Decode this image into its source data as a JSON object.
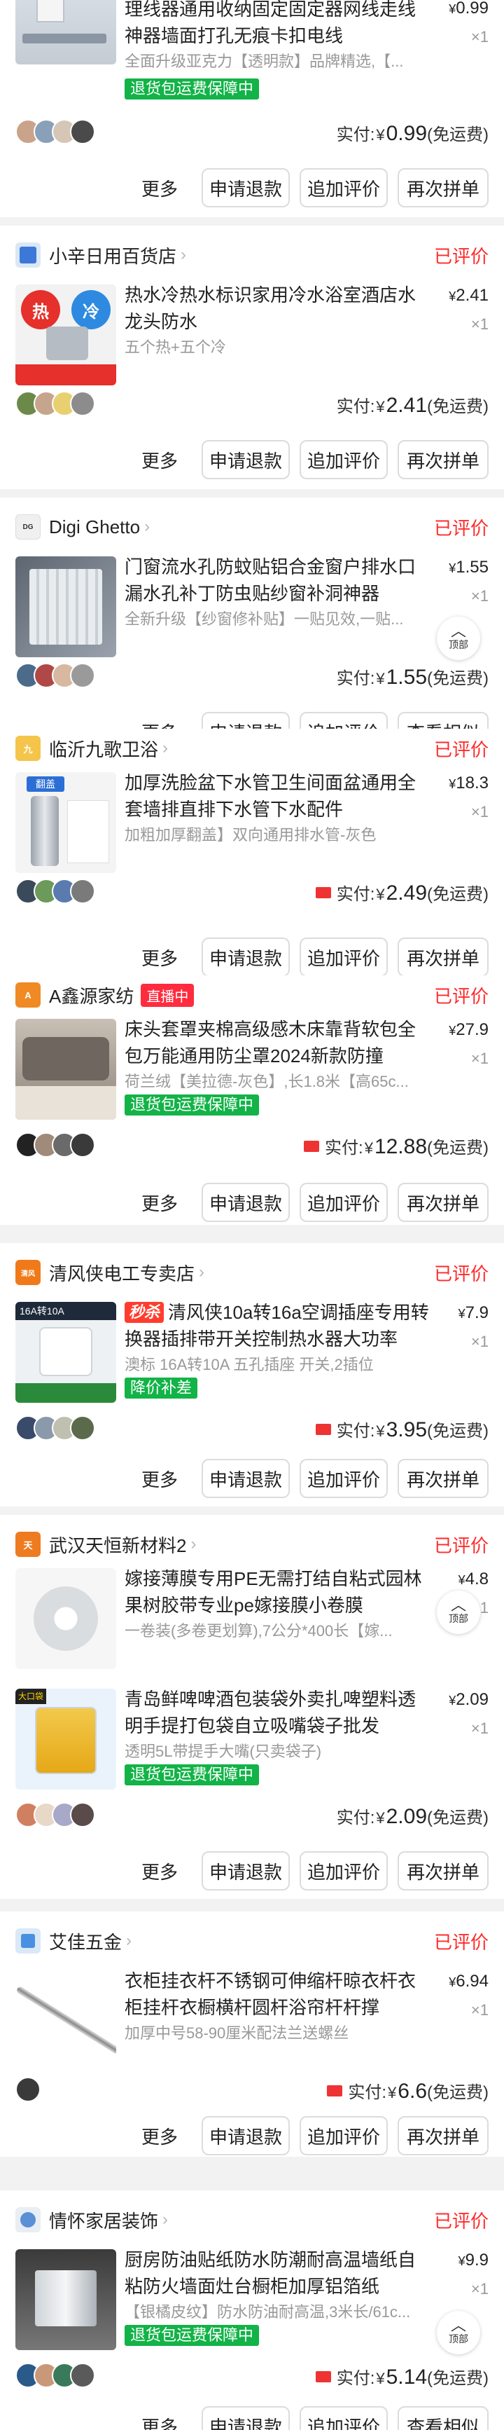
{
  "back_to_top_label": "顶部",
  "orders": [
    {
      "shop": "",
      "status": "",
      "title": "理线器通用收纳固定固定器网线走线神器墙面打孔无痕卡扣电线",
      "spec": "全面升级亚克力【透明款】品牌精选,【...",
      "tag": "退货包运费保障中",
      "price": "0.99",
      "qty": "×1",
      "paid_label": "实付:",
      "paid_currency": "¥",
      "paid_amount": "0.99",
      "paid_note": "(免运费)",
      "actions": [
        "更多",
        "申请退款",
        "追加评价",
        "再次拼单"
      ]
    },
    {
      "shop": "小辛日用百货店",
      "status": "已评价",
      "title": "热水冷热水标识家用冷水浴室酒店水龙头防水",
      "spec": "五个热+五个冷",
      "tag": "",
      "price": "2.41",
      "qty": "×1",
      "paid_label": "实付:",
      "paid_currency": "¥",
      "paid_amount": "2.41",
      "paid_note": "(免运费)",
      "actions": [
        "更多",
        "申请退款",
        "追加评价",
        "再次拼单"
      ]
    },
    {
      "shop": "Digi Ghetto",
      "status": "已评价",
      "title": "门窗流水孔防蚊贴铝合金窗户排水口漏水孔补丁防虫贴纱窗补洞神器",
      "spec": "全新升级【纱窗修补贴】一贴见效,一贴...",
      "tag": "",
      "price": "1.55",
      "qty": "×1",
      "paid_label": "实付:",
      "paid_currency": "¥",
      "paid_amount": "1.55",
      "paid_note": "(免运费)",
      "actions": [
        "更多",
        "申请退款",
        "追加评价",
        "查看相似"
      ]
    },
    {
      "shop": "临沂九歌卫浴",
      "status": "已评价",
      "title": "加厚洗脸盆下水管卫生间面盆通用全套墙排直排下水管下水配件",
      "spec": "加粗加厚翻盖】双向通用排水管-灰色",
      "tag": "",
      "price": "18.3",
      "qty": "×1",
      "paid_label": "实付:",
      "paid_currency": "¥",
      "paid_amount": "2.49",
      "paid_note": "(免运费)",
      "actions": [
        "更多",
        "申请退款",
        "追加评价",
        "再次拼单"
      ]
    },
    {
      "shop": "A鑫源家纺",
      "live": "直播中",
      "status": "已评价",
      "title": "床头套罩夹棉高级感木床靠背软包全包万能通用防尘罩2024新款防撞",
      "spec": "荷兰绒【美拉德-灰色】,长1.8米【高65c...",
      "tag": "退货包运费保障中",
      "price": "27.9",
      "qty": "×1",
      "paid_label": "实付:",
      "paid_currency": "¥",
      "paid_amount": "12.88",
      "paid_note": "(免运费)",
      "actions": [
        "更多",
        "申请退款",
        "追加评价",
        "再次拼单"
      ]
    },
    {
      "shop": "清风侠电工专卖店",
      "status": "已评价",
      "promo": "秒杀",
      "title": "清风侠10a转16a空调插座专用转换器插排带开关控制热水器大功率",
      "spec": "澳标 16A转10A 五孔插座 开关,2插位",
      "tag": "降价补差",
      "price": "7.9",
      "qty": "×1",
      "paid_label": "实付:",
      "paid_currency": "¥",
      "paid_amount": "3.95",
      "paid_note": "(免运费)",
      "actions": [
        "更多",
        "申请退款",
        "追加评价",
        "再次拼单"
      ]
    },
    {
      "shop": "武汉天恒新材料2",
      "status": "已评价",
      "title": "嫁接薄膜专用PE无需打结自粘式园林果树胶带专业pe嫁接膜小卷膜",
      "spec": "一卷装(多卷更划算),7公分*400长【嫁...",
      "tag": "",
      "price": "4.8",
      "qty": "×1",
      "actions": []
    },
    {
      "shop": "",
      "status": "",
      "title": "青岛鲜啤啤酒包装袋外卖扎啤塑料透明手提打包袋自立吸嘴袋子批发",
      "spec": "透明5L带提手大嘴(只卖袋子)",
      "tag": "退货包运费保障中",
      "price": "2.09",
      "qty": "×1",
      "paid_label": "实付:",
      "paid_currency": "¥",
      "paid_amount": "2.09",
      "paid_note": "(免运费)",
      "actions": [
        "更多",
        "申请退款",
        "追加评价",
        "再次拼单"
      ]
    },
    {
      "shop": "艾佳五金",
      "status": "已评价",
      "title": "衣柜挂衣杆不锈钢可伸缩杆晾衣杆衣柜挂杆衣橱横杆圆杆浴帘杆杆撑",
      "spec": "加厚中号58-90厘米配法兰送螺丝",
      "tag": "",
      "price": "6.94",
      "qty": "×1",
      "paid_label": "实付:",
      "paid_currency": "¥",
      "paid_amount": "6.6",
      "paid_note": "(免运费)",
      "actions": [
        "更多",
        "申请退款",
        "追加评价",
        "再次拼单"
      ]
    },
    {
      "shop": "情怀家居装饰",
      "status": "已评价",
      "title": "厨房防油贴纸防水防潮耐高温墙纸自粘防火墙面灶台橱柜加厚铝箔纸",
      "spec": "【银橘皮纹】防水防油耐高温,3米长/61c...",
      "tag": "退货包运费保障中",
      "price": "9.9",
      "qty": "×1",
      "paid_label": "实付:",
      "paid_currency": "¥",
      "paid_amount": "5.14",
      "paid_note": "(免运费)",
      "actions": [
        "更多",
        "申请退款",
        "追加评价",
        "查看相似"
      ]
    }
  ]
}
